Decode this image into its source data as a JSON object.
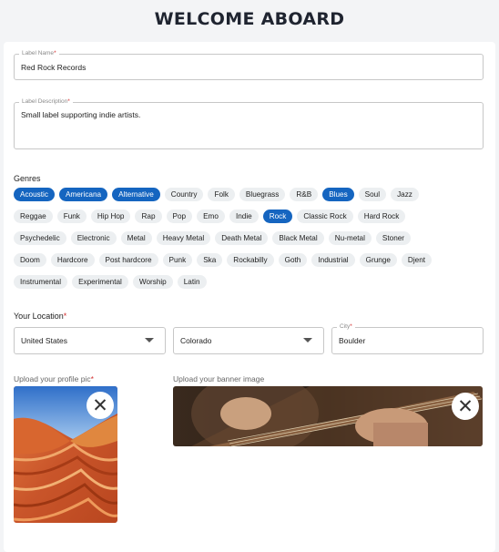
{
  "page": {
    "title": "WELCOME ABOARD"
  },
  "form": {
    "label_name": {
      "label": "Label Name",
      "required_mark": "*",
      "value": "Red Rock Records"
    },
    "label_description": {
      "label": "Label Description",
      "required_mark": "*",
      "value": "Small label supporting indie artists."
    },
    "genres": {
      "heading": "Genres",
      "rows": [
        [
          {
            "label": "Acoustic",
            "selected": true
          },
          {
            "label": "Americana",
            "selected": true
          },
          {
            "label": "Alternative",
            "selected": true
          },
          {
            "label": "Country",
            "selected": false
          },
          {
            "label": "Folk",
            "selected": false
          },
          {
            "label": "Bluegrass",
            "selected": false
          },
          {
            "label": "R&B",
            "selected": false
          },
          {
            "label": "Blues",
            "selected": true
          },
          {
            "label": "Soul",
            "selected": false
          },
          {
            "label": "Jazz",
            "selected": false
          }
        ],
        [
          {
            "label": "Reggae",
            "selected": false
          },
          {
            "label": "Funk",
            "selected": false
          },
          {
            "label": "Hip Hop",
            "selected": false
          },
          {
            "label": "Rap",
            "selected": false
          },
          {
            "label": "Pop",
            "selected": false
          },
          {
            "label": "Emo",
            "selected": false
          },
          {
            "label": "Indie",
            "selected": false
          },
          {
            "label": "Rock",
            "selected": true
          },
          {
            "label": "Classic Rock",
            "selected": false
          },
          {
            "label": "Hard Rock",
            "selected": false
          }
        ],
        [
          {
            "label": "Psychedelic",
            "selected": false
          },
          {
            "label": "Electronic",
            "selected": false
          },
          {
            "label": "Metal",
            "selected": false
          },
          {
            "label": "Heavy Metal",
            "selected": false
          },
          {
            "label": "Death Metal",
            "selected": false
          },
          {
            "label": "Black Metal",
            "selected": false
          },
          {
            "label": "Nu-metal",
            "selected": false
          },
          {
            "label": "Stoner",
            "selected": false
          }
        ],
        [
          {
            "label": "Doom",
            "selected": false
          },
          {
            "label": "Hardcore",
            "selected": false
          },
          {
            "label": "Post hardcore",
            "selected": false
          },
          {
            "label": "Punk",
            "selected": false
          },
          {
            "label": "Ska",
            "selected": false
          },
          {
            "label": "Rockabilly",
            "selected": false
          },
          {
            "label": "Goth",
            "selected": false
          },
          {
            "label": "Industrial",
            "selected": false
          },
          {
            "label": "Grunge",
            "selected": false
          },
          {
            "label": "Djent",
            "selected": false
          }
        ],
        [
          {
            "label": "Instrumental",
            "selected": false
          },
          {
            "label": "Experimental",
            "selected": false
          },
          {
            "label": "Worship",
            "selected": false
          },
          {
            "label": "Latin",
            "selected": false
          }
        ]
      ]
    },
    "location": {
      "heading": "Your Location",
      "required_mark": "*",
      "country": "United States",
      "state": "Colorado",
      "city_label": "City",
      "city_required_mark": "*",
      "city": "Boulder"
    },
    "uploads": {
      "profile_label": "Upload your profile pic",
      "profile_required_mark": "*",
      "banner_label": "Upload your banner image",
      "close_icon": "close-icon"
    }
  },
  "colors": {
    "accent": "#1565c0",
    "required": "#d32f2f",
    "chip_bg": "#eceff1"
  }
}
